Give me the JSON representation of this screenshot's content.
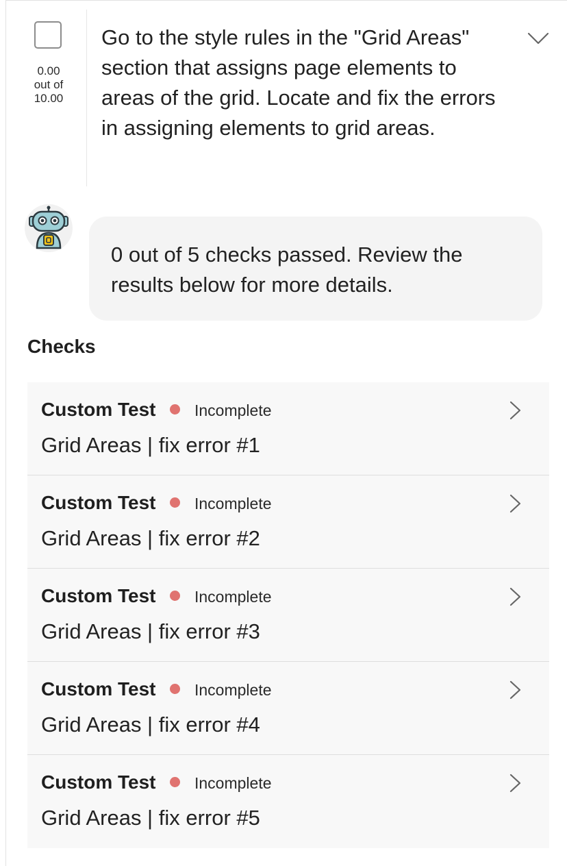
{
  "task": {
    "score_value": "0.00",
    "score_out_of": "out of",
    "score_max": "10.00",
    "description": "Go to the style rules in the \"Grid Areas\" section that assigns page elements to areas of the grid. Locate and fix the errors in assigning elements to grid areas.",
    "checkbox_checked": false
  },
  "bot": {
    "message": "0 out of 5 checks passed. Review the results below for more details."
  },
  "checks": {
    "heading": "Checks",
    "items": [
      {
        "type": "Custom Test",
        "status": "Incomplete",
        "name": "Grid Areas | fix error #1"
      },
      {
        "type": "Custom Test",
        "status": "Incomplete",
        "name": "Grid Areas | fix error #2"
      },
      {
        "type": "Custom Test",
        "status": "Incomplete",
        "name": "Grid Areas | fix error #3"
      },
      {
        "type": "Custom Test",
        "status": "Incomplete",
        "name": "Grid Areas | fix error #4"
      },
      {
        "type": "Custom Test",
        "status": "Incomplete",
        "name": "Grid Areas | fix error #5"
      }
    ]
  },
  "colors": {
    "status_incomplete": "#e07370",
    "bubble_background": "#f4f4f4",
    "row_background": "#f8f8f8"
  },
  "icons": {
    "expand": "chevron-down-icon",
    "open_check": "chevron-right-icon",
    "avatar": "robot-icon"
  }
}
